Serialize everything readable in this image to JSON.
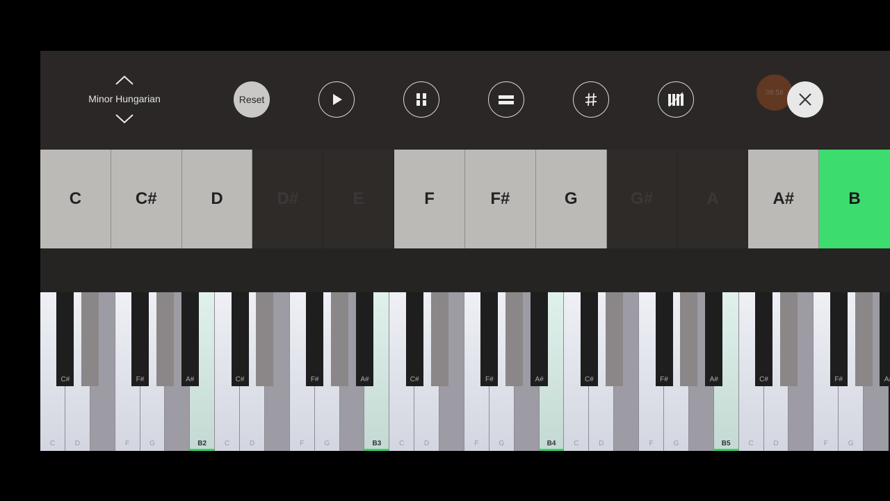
{
  "toolbar": {
    "scale_name": "Minor Hungarian",
    "reset_label": "Reset",
    "timer_text": "08:58",
    "icons": [
      "chevron-up-icon",
      "chevron-down-icon",
      "play-icon",
      "pause-bars-icon",
      "equals-icon",
      "sharp-icon",
      "piano-icon",
      "close-icon"
    ]
  },
  "note_buttons": [
    {
      "label": "C",
      "state": "on"
    },
    {
      "label": "C#",
      "state": "on"
    },
    {
      "label": "D",
      "state": "on"
    },
    {
      "label": "D#",
      "state": "off"
    },
    {
      "label": "E",
      "state": "off"
    },
    {
      "label": "F",
      "state": "on"
    },
    {
      "label": "F#",
      "state": "on"
    },
    {
      "label": "G",
      "state": "on"
    },
    {
      "label": "G#",
      "state": "off"
    },
    {
      "label": "A",
      "state": "off"
    },
    {
      "label": "A#",
      "state": "on"
    },
    {
      "label": "B",
      "state": "selected"
    }
  ],
  "keyboard": {
    "white_keys": [
      "C",
      "D",
      "",
      "F",
      "G",
      "",
      "B2",
      "C",
      "D",
      "",
      "F",
      "G",
      "",
      "B3",
      "C",
      "D",
      "",
      "F",
      "G",
      "",
      "B4",
      "C",
      "D",
      "",
      "F",
      "G",
      "",
      "B5",
      "C",
      "D",
      "",
      "F",
      "G",
      ""
    ],
    "black_keys": [
      "C#",
      "",
      "F#",
      "",
      "A#",
      "C#",
      "",
      "F#",
      "",
      "A#",
      "C#",
      "",
      "F#",
      "",
      "A#",
      "C#",
      "",
      "F#",
      "",
      "A#",
      "C#",
      "",
      "F#",
      "",
      "A#"
    ]
  },
  "colors": {
    "accent_green": "#3ddc6f",
    "key_in_scale": "#eef0f5",
    "key_out_of_scale": "#9d9ba3"
  }
}
